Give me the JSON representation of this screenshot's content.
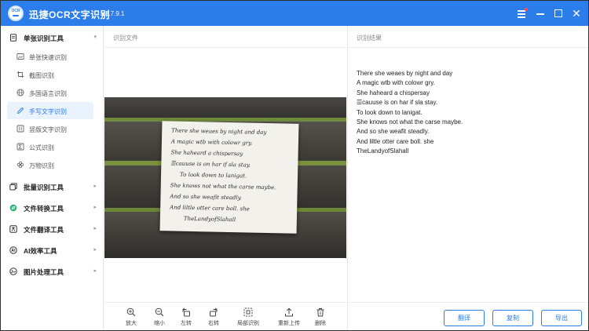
{
  "app": {
    "title": "迅捷OCR文字识别",
    "version": "v8.7.9.1",
    "logo_text": "OCR",
    "accent_color": "#2b7de9"
  },
  "window_controls": [
    "menu-icon",
    "minimize-icon",
    "maximize-icon",
    "close-icon"
  ],
  "sidebar": {
    "groups": [
      {
        "label": "单张识别工具",
        "icon": "document-icon",
        "expanded": true,
        "items": [
          {
            "label": "单张快速识别",
            "icon": "image-icon"
          },
          {
            "label": "截图识别",
            "icon": "crop-icon"
          },
          {
            "label": "多国语言识别",
            "icon": "globe-icon"
          },
          {
            "label": "手写文字识别",
            "icon": "pen-icon",
            "active": true
          },
          {
            "label": "竖版文字识别",
            "icon": "vertical-text-icon"
          },
          {
            "label": "公式识别",
            "icon": "formula-icon"
          },
          {
            "label": "万物识别",
            "icon": "flower-icon"
          }
        ]
      },
      {
        "label": "批量识别工具",
        "icon": "batch-icon"
      },
      {
        "label": "文件转换工具",
        "icon": "convert-icon"
      },
      {
        "label": "文件翻译工具",
        "icon": "translate-icon"
      },
      {
        "label": "AI效率工具",
        "icon": "ai-icon"
      },
      {
        "label": "图片处理工具",
        "icon": "image-process-icon"
      }
    ]
  },
  "left_pane": {
    "header": "识别文件",
    "toolbar": [
      {
        "label": "放大",
        "icon": "zoom-in-icon"
      },
      {
        "label": "缩小",
        "icon": "zoom-out-icon"
      },
      {
        "label": "左转",
        "icon": "rotate-left-icon"
      },
      {
        "label": "右转",
        "icon": "rotate-right-icon"
      },
      {
        "label": "局部识别",
        "icon": "partial-select-icon"
      },
      {
        "label": "重新上传",
        "icon": "upload-icon"
      },
      {
        "label": "删除",
        "icon": "trash-icon"
      }
    ]
  },
  "right_pane": {
    "header": "识别结果",
    "result_lines": [
      "There she weaes by night and day",
      "A magic wtb with colowr gry.",
      "She haheard a chispersay",
      "☰cauuse is on har if sla stay.",
      "To look down to lanigat.",
      "She knows not what the carse maybe.",
      "And so she weafit steadly.",
      "And liltle otter care boll. she",
      "TheLandyofSlahall"
    ],
    "buttons": {
      "translate": "翻译",
      "copy": "复制",
      "export": "导出"
    }
  }
}
